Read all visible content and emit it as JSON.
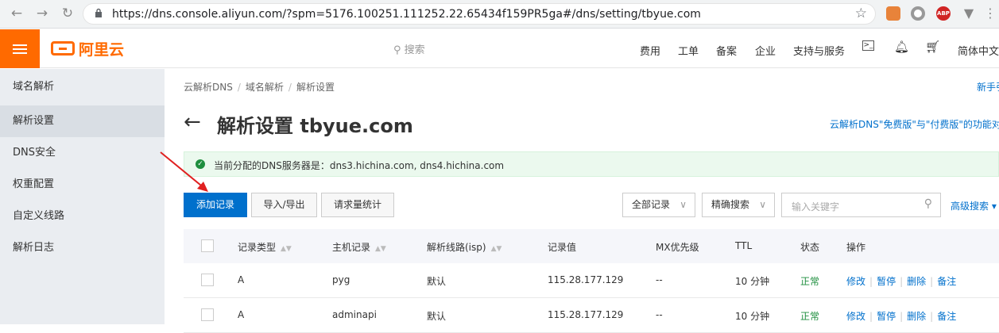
{
  "browser": {
    "url": "https://dns.console.aliyun.com/?spm=5176.100251.111252.22.65434f159PR5ga#/dns/setting/tbyue.com",
    "ext_abp": "ABP"
  },
  "topbar": {
    "logo": "阿里云",
    "search_placeholder": "搜索",
    "nav": [
      "费用",
      "工单",
      "备案",
      "企业",
      "支持与服务"
    ],
    "lang": "简体中文"
  },
  "sidebar": {
    "title": "域名解析",
    "items": [
      "解析设置",
      "DNS安全",
      "权重配置",
      "自定义线路",
      "解析日志"
    ]
  },
  "main": {
    "breadcrumb": [
      "云解析DNS",
      "域名解析",
      "解析设置"
    ],
    "newbie": "新手引",
    "title": "解析设置 tbyue.com",
    "compare_link": "云解析DNS\"免费版\"与\"付费版\"的功能对比",
    "notice": "当前分配的DNS服务器是：dns3.hichina.com, dns4.hichina.com",
    "buttons": {
      "add": "添加记录",
      "import": "导入/导出",
      "stats": "请求量统计"
    },
    "filter": {
      "all": "全部记录",
      "precise": "精确搜索",
      "keyword_placeholder": "输入关键字",
      "advanced": "高级搜索"
    }
  },
  "table": {
    "headers": [
      "记录类型",
      "主机记录",
      "解析线路(isp)",
      "记录值",
      "MX优先级",
      "TTL",
      "状态",
      "操作"
    ],
    "rows": [
      {
        "type": "A",
        "host": "pyg",
        "line": "默认",
        "value": "115.28.177.129",
        "mx": "--",
        "ttl": "10 分钟",
        "status": "正常"
      },
      {
        "type": "A",
        "host": "adminapi",
        "line": "默认",
        "value": "115.28.177.129",
        "mx": "--",
        "ttl": "10 分钟",
        "status": "正常"
      }
    ],
    "actions": [
      "修改",
      "暂停",
      "删除",
      "备注"
    ]
  },
  "colors": {
    "brand": "#ff6a00",
    "primary": "#0070cc",
    "success": "#1e8e3e",
    "annotation": "#e02020"
  }
}
